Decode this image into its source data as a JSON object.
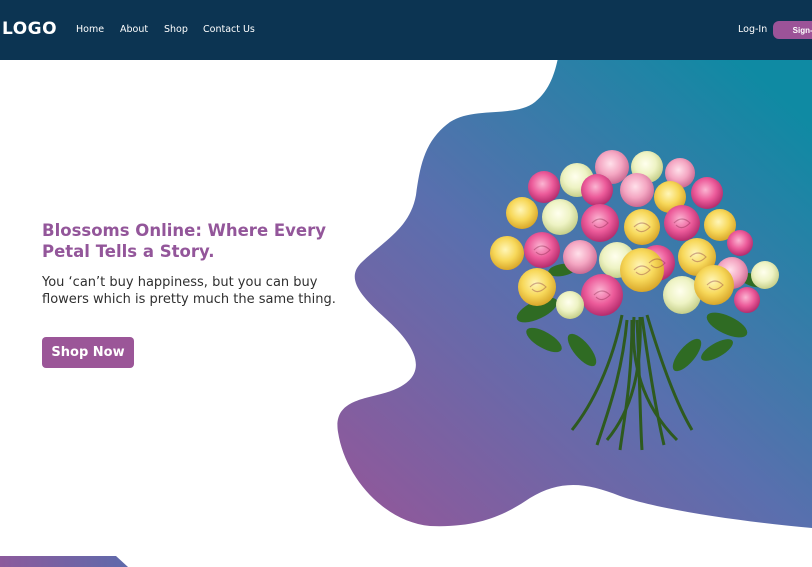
{
  "navbar": {
    "logo": "LOGO",
    "links": [
      "Home",
      "About",
      "Shop",
      "Contact Us"
    ],
    "login_label": "Log-In",
    "signup_label": "Sign-Up"
  },
  "hero": {
    "title": "Blossoms Online: Where Every Petal Tells a Story.",
    "subtitle": "You ‘can’t buy happiness, but you can buy flowers which is pretty much the same thing.",
    "cta_label": "Shop Now"
  },
  "colors": {
    "nav_bg": "#0c3452",
    "accent": "#9b5698",
    "blob_gradient_start": "#8c5a9c",
    "blob_gradient_end": "#0f8aa3"
  }
}
